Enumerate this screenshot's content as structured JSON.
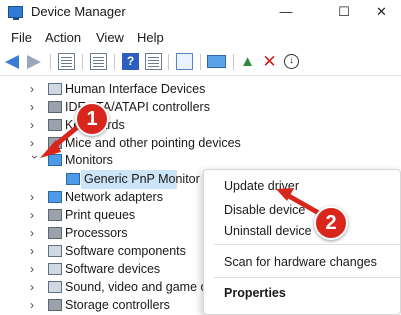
{
  "window": {
    "title": "Device Manager",
    "minimize": "—",
    "maximize": "☐",
    "close": "✕"
  },
  "menu": [
    "File",
    "Action",
    "View",
    "Help"
  ],
  "toolbar": {
    "icons": [
      "back-arrow-icon",
      "forward-arrow-icon",
      "properties-icon",
      "document-icon",
      "help-icon",
      "scan-icon",
      "monitor-icon",
      "enable-device-icon",
      "uninstall-device-icon",
      "disable-device-icon"
    ]
  },
  "tree": {
    "items": [
      {
        "label": "Human Interface Devices",
        "expanded": false
      },
      {
        "label": "IDE ATA/ATAPI controllers",
        "expanded": false
      },
      {
        "label": "Keyboards",
        "expanded": false
      },
      {
        "label": "Mice and other pointing devices",
        "expanded": false
      },
      {
        "label": "Monitors",
        "expanded": true
      },
      {
        "label": "Generic PnP Monitor",
        "child": true,
        "selected": true
      },
      {
        "label": "Network adapters",
        "expanded": false
      },
      {
        "label": "Print queues",
        "expanded": false
      },
      {
        "label": "Processors",
        "expanded": false
      },
      {
        "label": "Software components",
        "expanded": false
      },
      {
        "label": "Software devices",
        "expanded": false
      },
      {
        "label": "Sound, video and game controllers",
        "expanded": false
      },
      {
        "label": "Storage controllers",
        "expanded": false
      }
    ]
  },
  "context_menu": {
    "items": [
      "Update driver",
      "Disable device",
      "Uninstall device",
      "Scan for hardware changes",
      "Properties"
    ]
  },
  "annotations": {
    "step1": "1",
    "step2": "2",
    "color": "#d9261c"
  },
  "colors": {
    "selection": "#cce4f7",
    "accent": "#2f7bd6"
  }
}
